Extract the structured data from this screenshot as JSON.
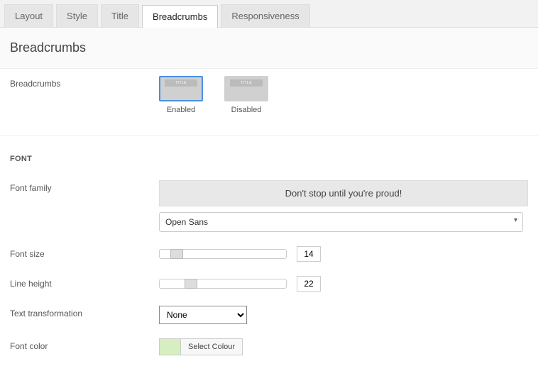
{
  "tabs": [
    {
      "label": "Layout"
    },
    {
      "label": "Style"
    },
    {
      "label": "Title"
    },
    {
      "label": "Breadcrumbs"
    },
    {
      "label": "Responsiveness"
    }
  ],
  "section": {
    "title": "Breadcrumbs"
  },
  "breadcrumbs_option": {
    "label": "Breadcrumbs",
    "enabled_caption": "Enabled",
    "disabled_caption": "Disabled",
    "thumb_text": "TITLE"
  },
  "font_section": {
    "heading": "FONT"
  },
  "font_family": {
    "label": "Font family",
    "banner": "Don't stop until you're proud!",
    "value": "Open Sans"
  },
  "font_size": {
    "label": "Font size",
    "value": "14"
  },
  "line_height": {
    "label": "Line height",
    "value": "22"
  },
  "text_transformation": {
    "label": "Text transformation",
    "value": "None"
  },
  "font_color": {
    "label": "Font color",
    "button": "Select Colour",
    "swatch": "#d6eec0"
  }
}
